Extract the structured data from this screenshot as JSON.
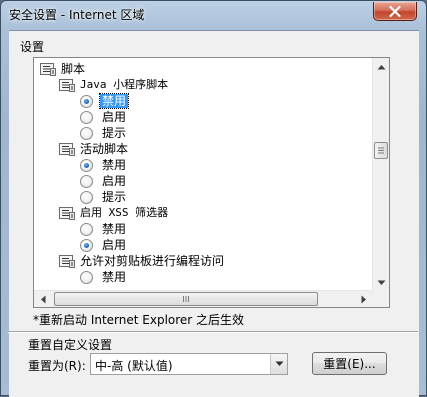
{
  "window": {
    "title": "安全设置 - Internet 区域",
    "close_symbol": "close-icon"
  },
  "settings": {
    "label": "设置",
    "tree": [
      {
        "type": "category",
        "label": "脚本",
        "level": 0,
        "icon": "settings-category-icon"
      },
      {
        "type": "category",
        "label": "Java 小程序脚本",
        "level": 1,
        "icon": "settings-category-icon"
      },
      {
        "type": "option",
        "label": "禁用",
        "level": 2,
        "checked": true,
        "selected": true
      },
      {
        "type": "option",
        "label": "启用",
        "level": 2,
        "checked": false
      },
      {
        "type": "option",
        "label": "提示",
        "level": 2,
        "checked": false
      },
      {
        "type": "category",
        "label": "活动脚本",
        "level": 1,
        "icon": "settings-category-icon"
      },
      {
        "type": "option",
        "label": "禁用",
        "level": 2,
        "checked": true
      },
      {
        "type": "option",
        "label": "启用",
        "level": 2,
        "checked": false
      },
      {
        "type": "option",
        "label": "提示",
        "level": 2,
        "checked": false
      },
      {
        "type": "category",
        "label": "启用 XSS 筛选器",
        "level": 1,
        "icon": "settings-category-icon"
      },
      {
        "type": "option",
        "label": "禁用",
        "level": 2,
        "checked": false
      },
      {
        "type": "option",
        "label": "启用",
        "level": 2,
        "checked": true
      },
      {
        "type": "category",
        "label": "允许对剪贴板进行编程访问",
        "level": 1,
        "icon": "settings-category-icon"
      },
      {
        "type": "option",
        "label": "禁用",
        "level": 2,
        "checked": false
      }
    ],
    "vscroll_position": 0.37,
    "restart_note": "*重新启动 Internet Explorer 之后生效"
  },
  "reset": {
    "group_title": "重置自定义设置",
    "reset_to_label": "重置为(R):",
    "level_value": "中-高 (默认值)",
    "reset_button": "重置(E)..."
  }
}
